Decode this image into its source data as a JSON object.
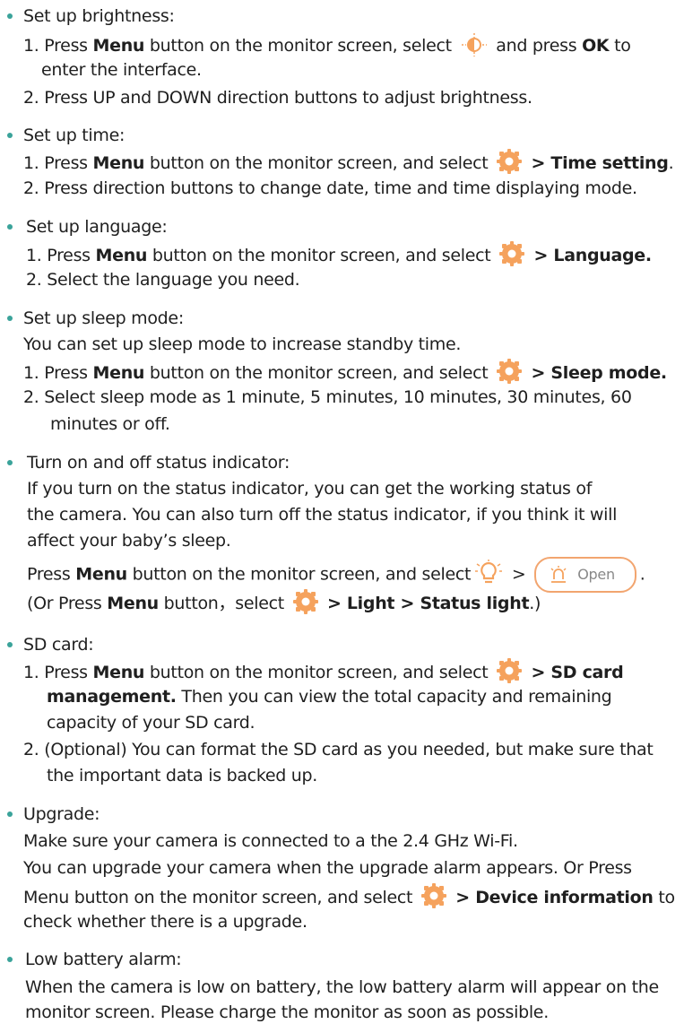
{
  "colors": {
    "bullet": "#3aa39a",
    "icon_orange": "#f5a25d",
    "text": "#1f1f1f"
  },
  "icons": [
    "brightness-icon",
    "gear-settings-icon",
    "light-bulb-icon",
    "alarm-open-icon"
  ],
  "sec1": {
    "head": "Set up brightness:",
    "l1a": "1. Press ",
    "l1b": "Menu",
    "l1c": " button on the monitor screen, select ",
    "l1d": " and press ",
    "l1e": "OK",
    "l1f": " to",
    "l1g": "enter the interface.",
    "l2": "2. Press UP and DOWN direction buttons to adjust brightness."
  },
  "sec2": {
    "head": "Set up time:",
    "l1a": "1. Press ",
    "l1b": "Menu",
    "l1c": " button on the monitor screen, and select ",
    "l1d": " > ",
    "l1e": "Time setting",
    "l1f": ".",
    "l2": "2. Press direction buttons to change date, time and time displaying mode."
  },
  "sec3": {
    "head": "Set up language:",
    "l1a": "1. Press ",
    "l1b": "Menu",
    "l1c": " button on the monitor screen, and select ",
    "l1d": " > ",
    "l1e": "Language.",
    "l2": "2. Select the language you need."
  },
  "sec4": {
    "head": "Set up sleep mode:",
    "intro": "You can set up sleep mode to increase standby time.",
    "l1a": "1. Press ",
    "l1b": "Menu",
    "l1c": " button on the monitor screen, and select ",
    "l1d": " > ",
    "l1e": "Sleep mode.",
    "l2a": "2. Select sleep mode as 1 minute, 5 minutes, 10 minutes, 30 minutes, 60",
    "l2b": "minutes or off."
  },
  "sec5": {
    "head": "Turn on and off status indicator:",
    "p1": "If you turn on the status indicator, you can get the working status of",
    "p2": "the camera. You can also turn off the status indicator, if you think it will",
    "p3": "affect your baby’s sleep.",
    "l1a": "Press ",
    "l1b": "Menu",
    "l1c": " button on the monitor screen, and select",
    "l1d": " > ",
    "l1e": ".",
    "pill": "Open",
    "l2a": "(Or Press ",
    "l2b": "Menu",
    "l2c": " button，select ",
    "l2d": " > ",
    "l2e": "Light",
    "l2f": " > ",
    "l2g": "Status light",
    "l2h": ".)"
  },
  "sec6": {
    "head": "SD card:",
    "l1a": "1. Press ",
    "l1b": "Menu",
    "l1c": " button on the monitor screen, and select ",
    "l1d": " > ",
    "l1e": "SD card",
    "l1f": "management.",
    "l1g": " Then you can view the total capacity and remaining",
    "l1h": "capacity of your SD card.",
    "l2a": "2. (Optional) You can format the SD card as you needed, but make sure that",
    "l2b": "the important data is backed up."
  },
  "sec7": {
    "head": "Upgrade:",
    "p1": "Make sure your camera is connected to a the 2.4 GHz Wi-Fi.",
    "p2": "You can upgrade your camera when the upgrade alarm appears. Or Press",
    "p3a": "Menu button on the monitor screen, and select ",
    "p3b": " > ",
    "p3c": "Device information",
    "p3d": " to",
    "p4": "check whether there is a upgrade."
  },
  "sec8": {
    "head": "Low battery alarm:",
    "p1": "When the camera is low on battery, the low battery alarm will appear on the",
    "p2": "monitor screen. Please charge the monitor as soon as possible."
  }
}
